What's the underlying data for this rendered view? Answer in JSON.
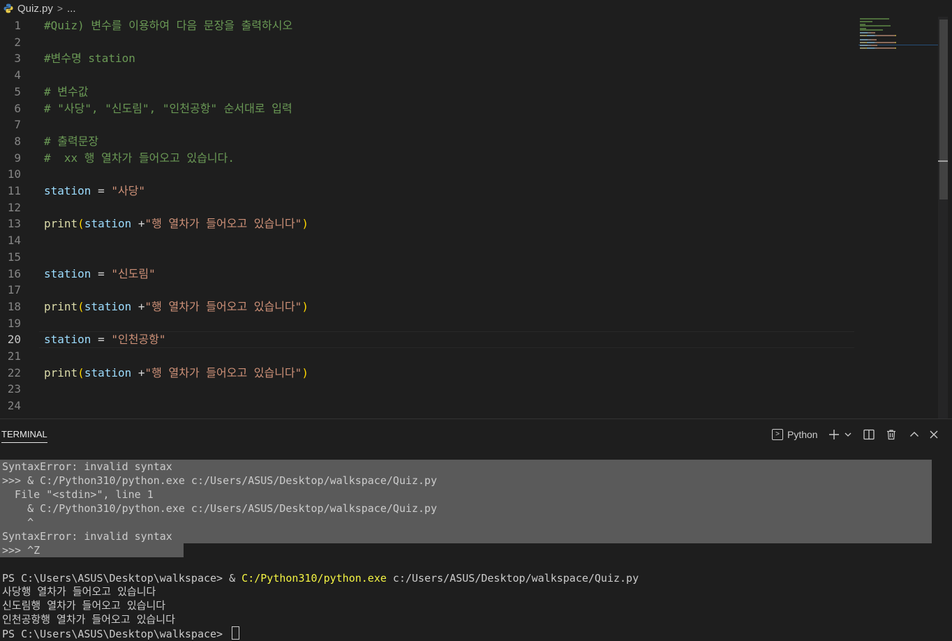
{
  "breadcrumb": {
    "file": "Quiz.py",
    "separator": ">",
    "more": "..."
  },
  "editor": {
    "active_line": 20,
    "lines": [
      {
        "n": "1",
        "tokens": [
          {
            "t": "#Quiz) 변수를 이용하여 다음 문장을 출력하시오",
            "c": "cm"
          }
        ]
      },
      {
        "n": "2",
        "tokens": []
      },
      {
        "n": "3",
        "tokens": [
          {
            "t": "#변수명 station",
            "c": "cm"
          }
        ]
      },
      {
        "n": "4",
        "tokens": []
      },
      {
        "n": "5",
        "tokens": [
          {
            "t": "# 변수값",
            "c": "cm"
          }
        ]
      },
      {
        "n": "6",
        "tokens": [
          {
            "t": "# \"사당\", \"신도림\", \"인천공항\" 순서대로 입력",
            "c": "cm"
          }
        ]
      },
      {
        "n": "7",
        "tokens": []
      },
      {
        "n": "8",
        "tokens": [
          {
            "t": "# 출력문장",
            "c": "cm"
          }
        ]
      },
      {
        "n": "9",
        "tokens": [
          {
            "t": "#  xx 행 열차가 들어오고 있습니다.",
            "c": "cm"
          }
        ]
      },
      {
        "n": "10",
        "tokens": []
      },
      {
        "n": "11",
        "tokens": [
          {
            "t": "station",
            "c": "var"
          },
          {
            "t": " = ",
            "c": "op"
          },
          {
            "t": "\"사당\"",
            "c": "str"
          }
        ]
      },
      {
        "n": "12",
        "tokens": []
      },
      {
        "n": "13",
        "tokens": [
          {
            "t": "print",
            "c": "fn"
          },
          {
            "t": "(",
            "c": "pn"
          },
          {
            "t": "station",
            "c": "var"
          },
          {
            "t": " +",
            "c": "op"
          },
          {
            "t": "\"행 열차가 들어오고 있습니다\"",
            "c": "str"
          },
          {
            "t": ")",
            "c": "pn"
          }
        ]
      },
      {
        "n": "14",
        "tokens": []
      },
      {
        "n": "15",
        "tokens": []
      },
      {
        "n": "16",
        "tokens": [
          {
            "t": "station",
            "c": "var"
          },
          {
            "t": " = ",
            "c": "op"
          },
          {
            "t": "\"신도림\"",
            "c": "str"
          }
        ]
      },
      {
        "n": "17",
        "tokens": []
      },
      {
        "n": "18",
        "tokens": [
          {
            "t": "print",
            "c": "fn"
          },
          {
            "t": "(",
            "c": "pn"
          },
          {
            "t": "station",
            "c": "var"
          },
          {
            "t": " +",
            "c": "op"
          },
          {
            "t": "\"행 열차가 들어오고 있습니다\"",
            "c": "str"
          },
          {
            "t": ")",
            "c": "pn"
          }
        ]
      },
      {
        "n": "19",
        "tokens": []
      },
      {
        "n": "20",
        "tokens": [
          {
            "t": "station",
            "c": "var"
          },
          {
            "t": " = ",
            "c": "op"
          },
          {
            "t": "\"인천공항\"",
            "c": "str"
          }
        ]
      },
      {
        "n": "21",
        "tokens": []
      },
      {
        "n": "22",
        "tokens": [
          {
            "t": "print",
            "c": "fn"
          },
          {
            "t": "(",
            "c": "pn"
          },
          {
            "t": "station",
            "c": "var"
          },
          {
            "t": " +",
            "c": "op"
          },
          {
            "t": "\"행 열차가 들어오고 있습니다\"",
            "c": "str"
          },
          {
            "t": ")",
            "c": "pn"
          }
        ]
      },
      {
        "n": "23",
        "tokens": []
      },
      {
        "n": "24",
        "tokens": []
      }
    ]
  },
  "terminal": {
    "tab_label": "TERMINAL",
    "profile_label": "Python",
    "icons": [
      "terminal-profile-icon",
      "plus-icon",
      "chevron-down-icon",
      "split-icon",
      "trash-icon",
      "chevron-up-icon",
      "close-icon"
    ],
    "selected_lines": [
      "SyntaxError: invalid syntax",
      ">>> & C:/Python310/python.exe c:/Users/ASUS/Desktop/walkspace/Quiz.py",
      "  File \"<stdin>\", line 1",
      "    & C:/Python310/python.exe c:/Users/ASUS/Desktop/walkspace/Quiz.py",
      "    ^",
      "SyntaxError: invalid syntax",
      ">>> ^Z"
    ],
    "prompt": "PS C:\\Users\\ASUS\\Desktop\\walkspace> ",
    "command_amp": "& ",
    "command_exe": "C:/Python310/python.exe",
    "command_arg": " c:/Users/ASUS/Desktop/walkspace/Quiz.py",
    "output_lines": [
      "사당행 열차가 들어오고 있습니다",
      "신도림행 열차가 들어오고 있습니다",
      "인천공항행 열차가 들어오고 있습니다"
    ],
    "final_prompt": "PS C:\\Users\\ASUS\\Desktop\\walkspace> "
  },
  "colors": {
    "background": "#1e1e1e",
    "comment": "#6a9955",
    "variable": "#9cdcfe",
    "function": "#dcdcaa",
    "string": "#ce9178",
    "bracket": "#ffd700",
    "selection": "#5a5a5a",
    "exe_highlight": "#f5f543"
  }
}
